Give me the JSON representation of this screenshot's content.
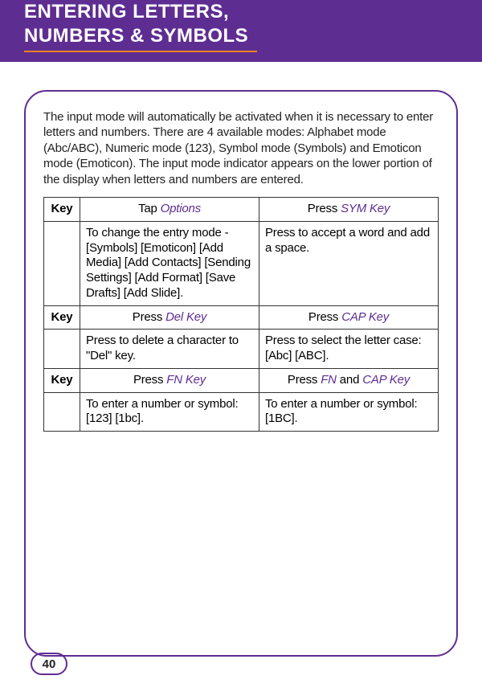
{
  "header": {
    "title_line1": "ENTERING LETTERS,",
    "title_line2": "NUMBERS & SYMBOLS"
  },
  "intro": "The input mode will automatically be activated when it is necessary to enter letters and numbers. There are 4 available modes: Alphabet mode (Abc/ABC), Numeric mode (123), Symbol mode (Symbols) and Emoticon mode (Emoticon). The input mode indicator appears on the lower portion of the display when letters and numbers are entered.",
  "rows": {
    "r1": {
      "key": "Key",
      "a_prefix": "Tap ",
      "a_em": "Options",
      "b_prefix": "Press ",
      "b_em": "SYM Key"
    },
    "r2": {
      "a": "To change the entry mode - [Symbols] [Emoticon] [Add Media] [Add Contacts] [Sending Settings] [Add Format] [Save Drafts] [Add Slide].",
      "b": "Press to accept a word and add a space."
    },
    "r3": {
      "key": "Key",
      "a_prefix": "Press ",
      "a_em": "Del Key",
      "b_prefix": "Press ",
      "b_em": "CAP Key"
    },
    "r4": {
      "a": "Press to delete a character to \"Del\" key.",
      "b": "Press to select the letter case: [Abc] [ABC]."
    },
    "r5": {
      "key": "Key",
      "a_prefix": "Press ",
      "a_em": "FN Key",
      "b_prefix": "Press ",
      "b_em1": "FN",
      "b_mid": " and ",
      "b_em2": "CAP Key"
    },
    "r6": {
      "a": "To enter a number or symbol: [123] [1bc].",
      "b": "To enter a number or symbol: [1BC]."
    }
  },
  "page_number": "40"
}
